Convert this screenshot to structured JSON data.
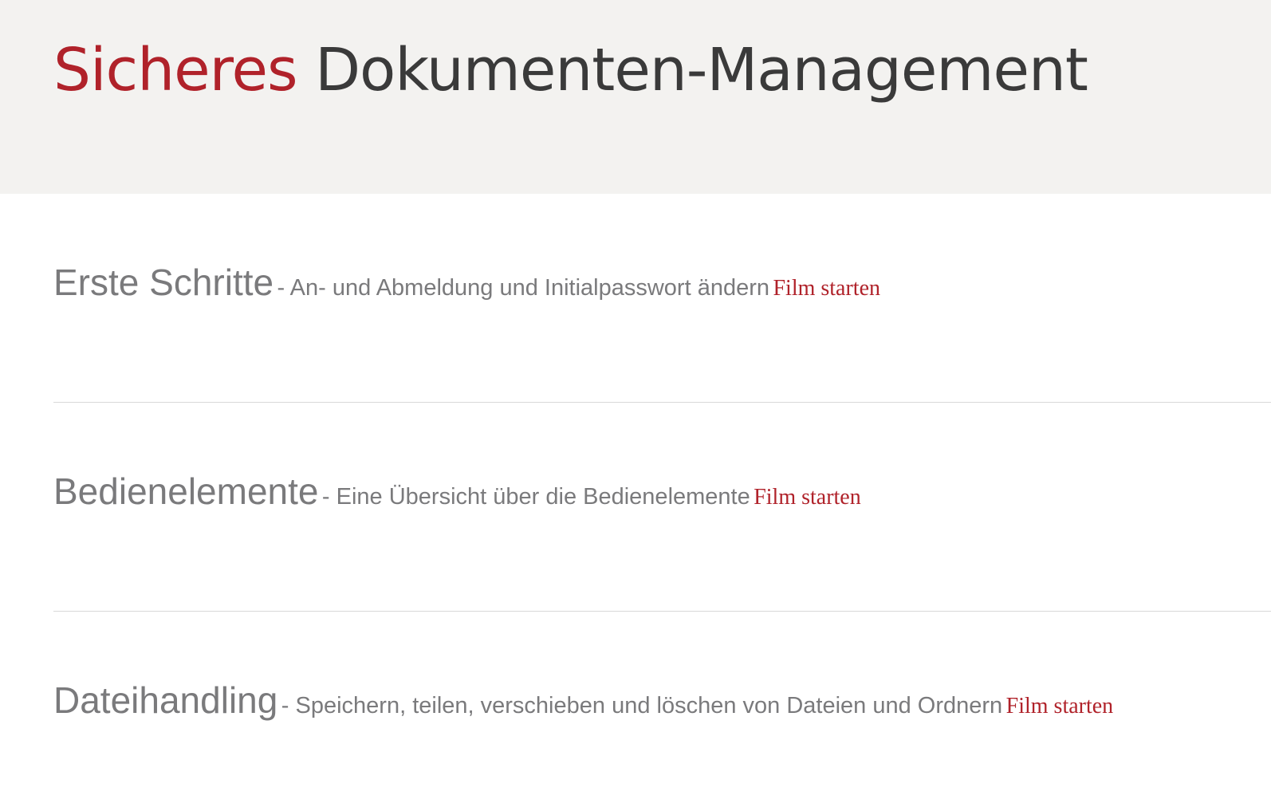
{
  "hero": {
    "title_accent": "Sicheres",
    "title_rest": "Dokumenten-Management"
  },
  "sections": [
    {
      "title": "Erste Schritte",
      "description": "- An- und Abmeldung und Initialpasswort ändern",
      "link_label": "Film starten"
    },
    {
      "title": "Bedienelemente",
      "description": "- Eine Übersicht über die Bedienelemente",
      "link_label": "Film starten"
    },
    {
      "title": "Dateihandling",
      "description": "- Speichern, teilen, verschieben und löschen von Dateien und Ordnern",
      "link_label": "Film starten"
    }
  ],
  "colors": {
    "accent": "#b0222a",
    "hero_background": "#f3f2f0",
    "text_gray": "#7a7a7c",
    "title_dark": "#3a3a3a"
  }
}
